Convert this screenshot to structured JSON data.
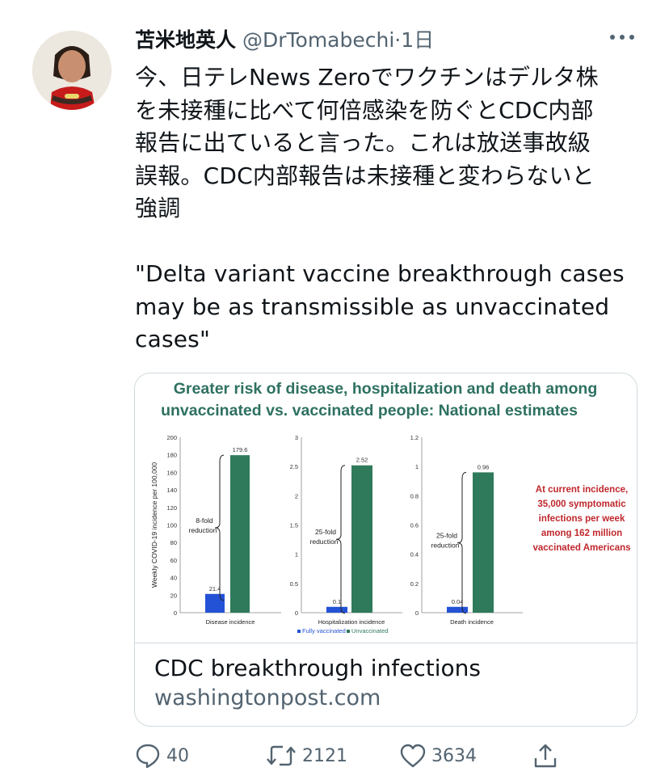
{
  "tweet": {
    "author_name": "苫米地英人",
    "handle": "@DrTomabechi",
    "separator": "·",
    "time": "1日",
    "text": "今、日テレNews Zeroでワクチンはデルタ株\nを未接種に比べて何倍感染を防ぐとCDC内部\n報告に出ていると言った。これは放送事故級\n誤報。CDC内部報告は未接種と変わらないと\n強調\n\n\"Delta variant vaccine breakthrough cases\nmay be as transmissible as unvaccinated\ncases\""
  },
  "card": {
    "title": "CDC breakthrough infections",
    "domain": "washingtonpost.com",
    "image": {
      "headline_line1": "Greater risk of disease, hospitalization and death among",
      "headline_line2": "unvaccinated vs. vaccinated people: National estimates",
      "note_lines": [
        "At current incidence,",
        "35,000 symptomatic",
        "infections per week",
        "among 162 million",
        "vaccinated Americans"
      ],
      "legend_fully": "Fully vaccinated",
      "legend_unvax": "Unvaccinated"
    }
  },
  "actions": {
    "reply_count": "40",
    "retweet_count": "2121",
    "like_count": "3634"
  },
  "colors": {
    "vaccinated": "#2452d6",
    "unvaccinated": "#2f7a5a",
    "headline": "#2e7161",
    "note": "#c0272d",
    "secondary_text": "#536471"
  },
  "chart_data": [
    {
      "type": "bar",
      "categories": [
        "Disease incidence"
      ],
      "series": [
        {
          "name": "Fully vaccinated",
          "values": [
            21.4
          ]
        },
        {
          "name": "Unvaccinated",
          "values": [
            179.6
          ]
        }
      ],
      "ylabel": "Weekly COVID-19 incidence per 100,000",
      "yticks": [
        0,
        20,
        40,
        60,
        80,
        100,
        120,
        140,
        160,
        180,
        200
      ],
      "ylim": [
        0,
        200
      ],
      "value_labels": [
        "21.4",
        "179.6"
      ],
      "annotation": "8-fold reduction"
    },
    {
      "type": "bar",
      "categories": [
        "Hospitalization incidence"
      ],
      "series": [
        {
          "name": "Fully vaccinated",
          "values": [
            0.1
          ]
        },
        {
          "name": "Unvaccinated",
          "values": [
            2.52
          ]
        }
      ],
      "yticks": [
        0,
        0.5,
        1,
        1.5,
        2,
        2.5,
        3
      ],
      "ylim": [
        0,
        3
      ],
      "value_labels": [
        "0.1",
        "2.52"
      ],
      "annotation": "25-fold reduction"
    },
    {
      "type": "bar",
      "categories": [
        "Death incidence"
      ],
      "series": [
        {
          "name": "Fully vaccinated",
          "values": [
            0.04
          ]
        },
        {
          "name": "Unvaccinated",
          "values": [
            0.96
          ]
        }
      ],
      "yticks": [
        0,
        0.2,
        0.4,
        0.6,
        0.8,
        1,
        1.2
      ],
      "ylim": [
        0,
        1.2
      ],
      "value_labels": [
        "0.04",
        "0.96"
      ],
      "annotation": "25-fold reduction"
    }
  ]
}
